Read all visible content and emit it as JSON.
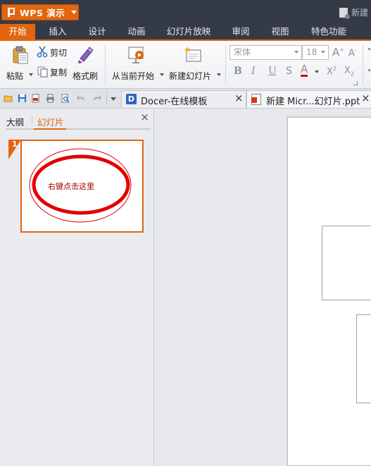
{
  "app": {
    "name": "WPS 演示",
    "new_label": "新建"
  },
  "menu_tabs": [
    {
      "label": "开始",
      "active": true
    },
    {
      "label": "插入"
    },
    {
      "label": "设计"
    },
    {
      "label": "动画"
    },
    {
      "label": "幻灯片放映"
    },
    {
      "label": "审阅"
    },
    {
      "label": "视图"
    },
    {
      "label": "特色功能"
    }
  ],
  "ribbon": {
    "paste": "粘贴",
    "cut": "剪切",
    "copy": "复制",
    "format_painter": "格式刷",
    "from_current": "从当前开始",
    "new_slide": "新建幻灯片",
    "font_name": "宋体",
    "font_size": "18"
  },
  "doc_tabs": [
    {
      "label": "Docer-在线模板"
    },
    {
      "label": "新建 Micr...幻灯片.ppt"
    }
  ],
  "left_panel": {
    "tab_outline": "大纲",
    "tab_slides": "幻灯片",
    "slide_number": "1",
    "thumbnail_text": "右键点击这里"
  },
  "colors": {
    "accent": "#e2650f",
    "titlebar": "#353b46",
    "annotation_red": "#e00000"
  }
}
